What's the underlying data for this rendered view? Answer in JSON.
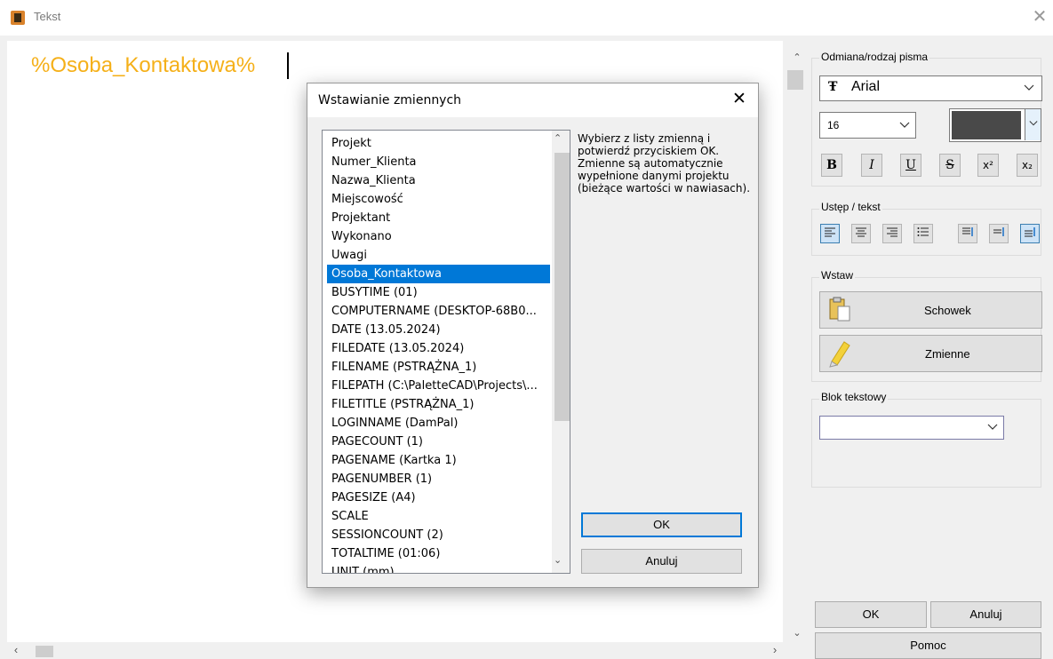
{
  "window": {
    "title": "Tekst",
    "close_glyph": "✕"
  },
  "editor": {
    "text": "%Osoba_Kontaktowa%"
  },
  "scroll": {
    "up": "⌃",
    "down": "⌄",
    "left": "‹",
    "right": "›"
  },
  "font_group": {
    "label": "Odmiana/rodzaj pisma",
    "font_name": "Arial",
    "font_glyph": "Ŧ",
    "size": "16",
    "color": "#494949",
    "buttons": [
      "B",
      "I",
      "U",
      "S",
      "x²",
      "x₂"
    ]
  },
  "para_group": {
    "label": "Ustęp / tekst"
  },
  "insert_group": {
    "label": "Wstaw",
    "clipboard": "Schowek",
    "variables": "Zmienne"
  },
  "block_group": {
    "label": "Blok tekstowy"
  },
  "bottom": {
    "ok": "OK",
    "cancel": "Anuluj",
    "help": "Pomoc"
  },
  "modal": {
    "title": "Wstawianie zmiennych",
    "close_glyph": "✕",
    "hint": "Wybierz z listy zmienną i potwierdź przyciskiem OK. Zmienne są automatycznie wypełnione danymi projektu (bieżące wartości w nawiasach).",
    "ok": "OK",
    "cancel": "Anuluj",
    "items": [
      "Projekt",
      "Numer_Klienta",
      "Nazwa_Klienta",
      "Miejscowość",
      "Projektant",
      "Wykonano",
      "Uwagi",
      "Osoba_Kontaktowa",
      "BUSYTIME (01)",
      "COMPUTERNAME (DESKTOP-68B0...",
      "DATE (13.05.2024)",
      "FILEDATE (13.05.2024)",
      "FILENAME (PSTRĄŻNA_1)",
      "FILEPATH (C:\\PaletteCAD\\Projects\\...",
      "FILETITLE (PSTRĄŻNA_1)",
      "LOGINNAME (DamPal)",
      "PAGECOUNT (1)",
      "PAGENAME (Kartka 1)",
      "PAGENUMBER (1)",
      "PAGESIZE (A4)",
      "SCALE",
      "SESSIONCOUNT (2)",
      "TOTALTIME (01:06)",
      "UNIT (mm)"
    ],
    "selected_index": 7
  },
  "icons": {
    "app": "app-icon",
    "font": "truetype-font-icon",
    "clipboard": "clipboard-icon",
    "variables": "pencil-icon",
    "chevron": "chevron-down-icon"
  }
}
